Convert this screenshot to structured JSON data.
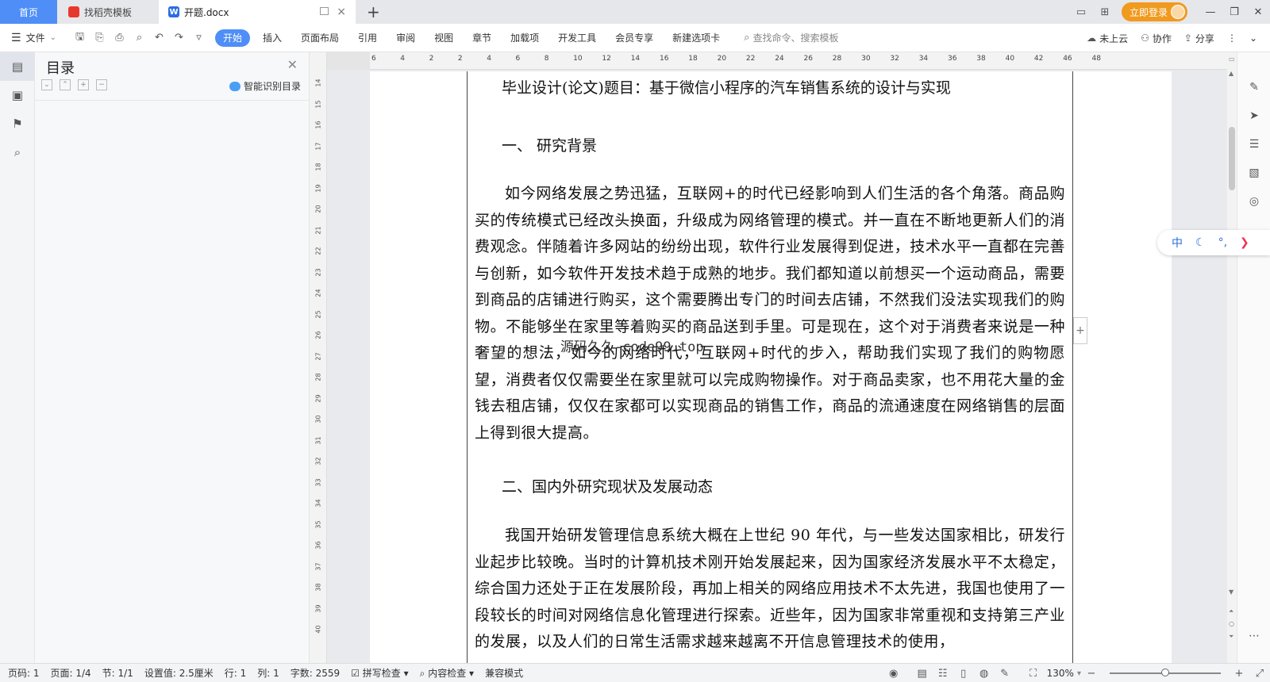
{
  "tabs": {
    "home": "首页",
    "find_template": "找稻壳模板",
    "doc": "开题.docx",
    "add": "+",
    "close": "×"
  },
  "titlebar": {
    "login": "立即登录"
  },
  "ribbon": {
    "file": "文件",
    "tabs": [
      "开始",
      "插入",
      "页面布局",
      "引用",
      "审阅",
      "视图",
      "章节",
      "加载项",
      "开发工具",
      "会员专享",
      "新建选项卡"
    ],
    "search_placeholder": "查找命令、搜索模板",
    "cloud": "未上云",
    "collab": "协作",
    "share": "分享"
  },
  "toc": {
    "title": "目录",
    "smart": "智能识别目录"
  },
  "ruler": {
    "h": [
      "6",
      "4",
      "2",
      "2",
      "4",
      "6",
      "8",
      "10",
      "12",
      "14",
      "16",
      "18",
      "20",
      "22",
      "24",
      "26",
      "28",
      "30",
      "32",
      "34",
      "36",
      "38",
      "40",
      "42",
      "46",
      "48"
    ],
    "v": [
      "14",
      "15",
      "16",
      "17",
      "18",
      "19",
      "20",
      "21",
      "22",
      "23",
      "24",
      "25",
      "26",
      "27",
      "28",
      "29",
      "30",
      "31",
      "32",
      "33",
      "34",
      "35",
      "36",
      "37",
      "38",
      "39",
      "40"
    ]
  },
  "document": {
    "title": "毕业设计(论文)题目：基于微信小程序的汽车销售系统的设计与实现",
    "section1": "一、  研究背景",
    "para1": "如今网络发展之势迅猛，互联网+的时代已经影响到人们生活的各个角落。商品购买的传统模式已经改头换面，升级成为网络管理的模式。并一直在不断地更新人们的消费观念。伴随着许多网站的纷纷出现，软件行业发展得到促进，技术水平一直都在完善与创新，如今软件开发技术趋于成熟的地步。我们都知道以前想买一个运动商品，需要到商品的店铺进行购买，这个需要腾出专门的时间去店铺，不然我们没法实现我们的购物。不能够坐在家里等着购买的商品送到手里。可是现在，这个对于消费者来说是一种奢望的想法，如今的网络时代，互联网+时代的步入，帮助我们实现了我们的购物愿望，消费者仅仅需要坐在家里就可以完成购物操作。对于商品卖家，也不用花大量的金钱去租店铺，仅仅在家都可以实现商品的销售工作，商品的流通速度在网络销售的层面上得到很大提高。",
    "section2": "二、国内外研究现状及发展动态",
    "para2": "我国开始研发管理信息系统大概在上世纪 90 年代，与一些发达国家相比，研发行业起步比较晚。当时的计算机技术刚开始发展起来，因为国家经济发展水平不太稳定，综合国力还处于正在发展阶段，再加上相关的网络应用技术不太先进，我国也使用了一段较长的时间对网络信息化管理进行探索。近些年，因为国家非常重视和支持第三产业的发展，以及人们的日常生活需求越来越离不开信息管理技术的使用，",
    "watermark": "源码久久-code99.top"
  },
  "ime": {
    "lang": "中"
  },
  "status": {
    "page_num": "页码: 1",
    "pages": "页面: 1/4",
    "section": "节: 1/1",
    "setting": "设置值: 2.5厘米",
    "row": "行: 1",
    "col": "列: 1",
    "words": "字数: 2559",
    "spell": "拼写检查",
    "content_check": "内容检查",
    "compat": "兼容模式",
    "zoom": "130%",
    "zoom_fraction": 0.5
  }
}
